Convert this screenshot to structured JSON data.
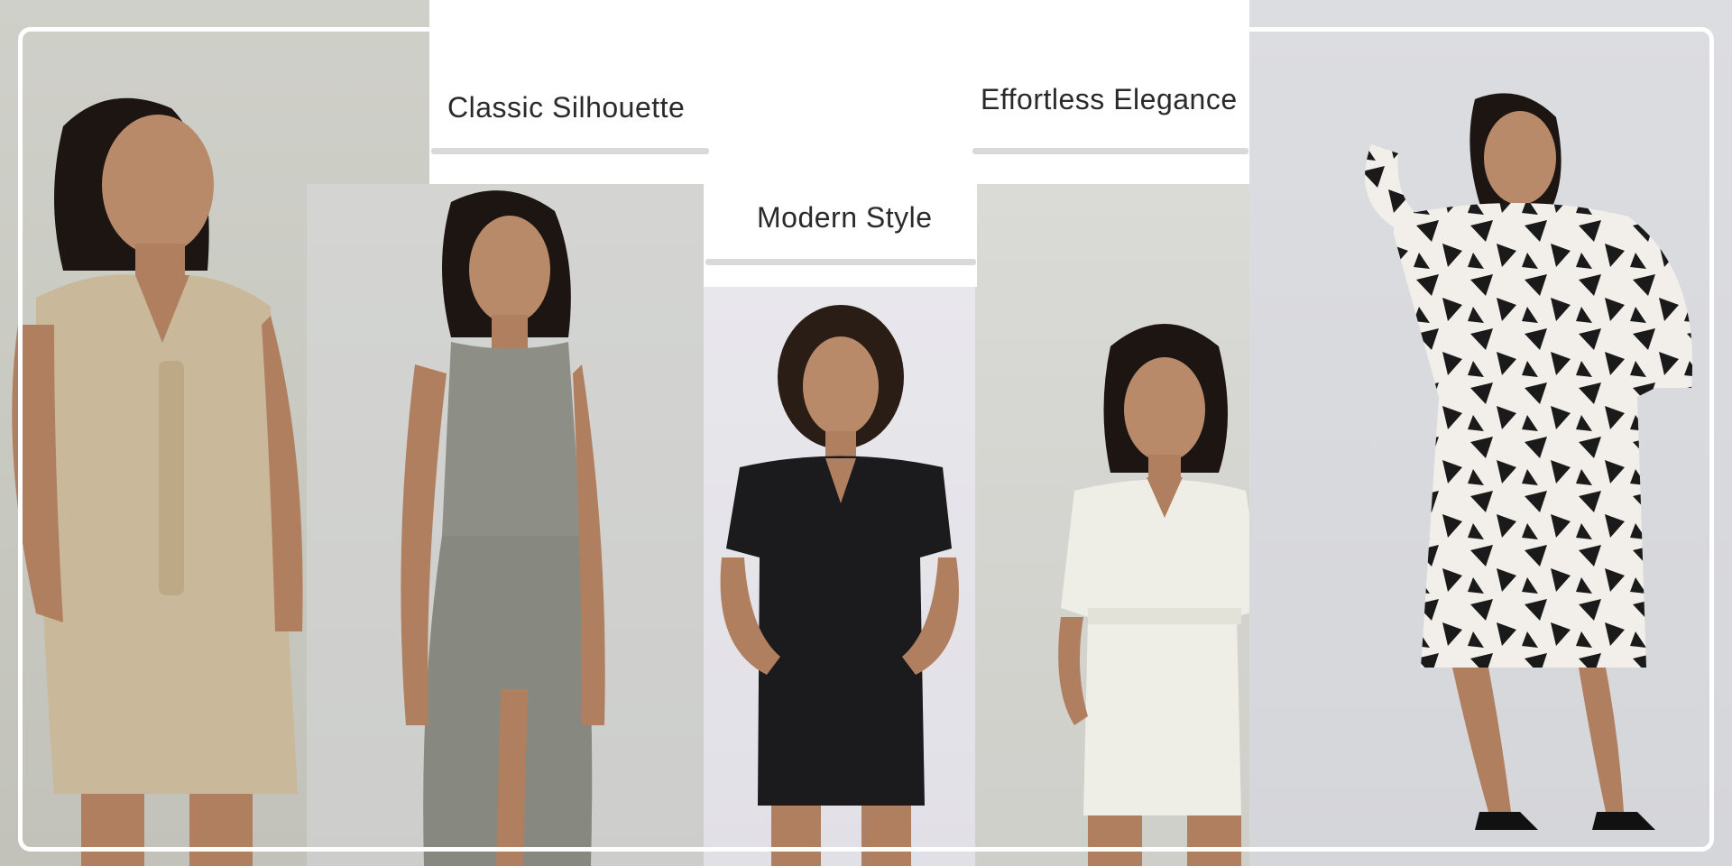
{
  "captions": {
    "classic": "Classic Silhouette",
    "modern": "Modern Style",
    "elegance": "Effortless Elegance"
  },
  "garments": [
    {
      "name": "beige sleeveless romper",
      "color": "#c9b89a"
    },
    {
      "name": "grey sleeveless wrap dress",
      "color": "#8d8f86"
    },
    {
      "name": "black short-sleeve romper",
      "color": "#1b1b1d"
    },
    {
      "name": "white collared romper",
      "color": "#eeeee6"
    },
    {
      "name": "black and white print wrap dress",
      "color": "#1a1a1a"
    }
  ],
  "colors": {
    "frame": "#ffffff",
    "caption_text": "#2a2a2a",
    "skin": "#b88a6a",
    "hair": "#1c1512"
  }
}
